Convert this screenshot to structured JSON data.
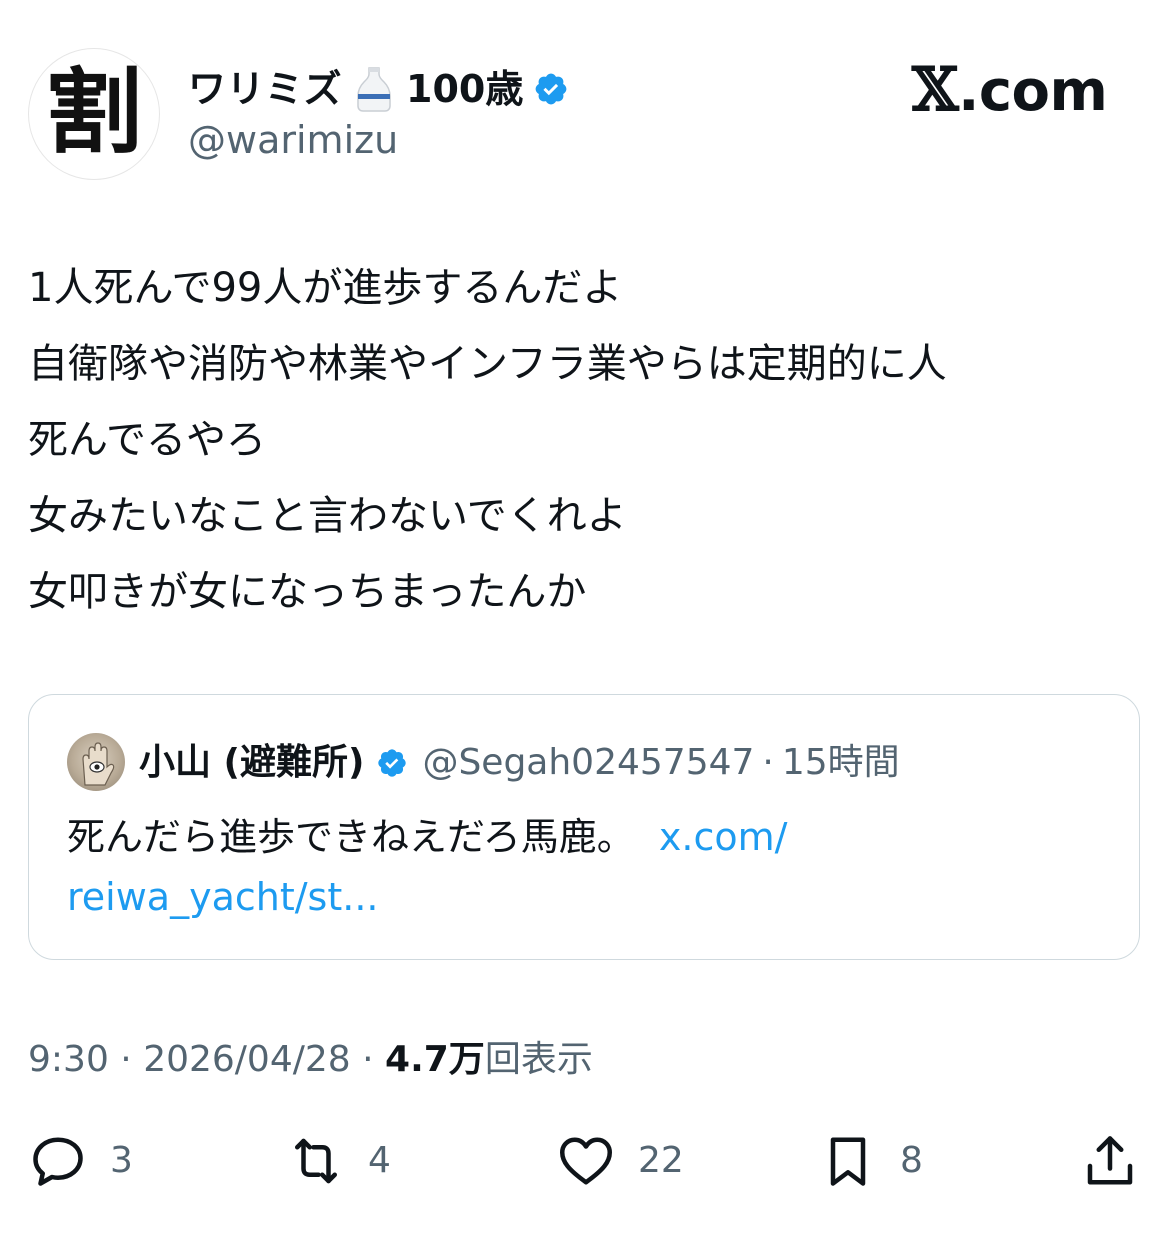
{
  "author": {
    "avatar_glyph": "割",
    "display_name": "ワリミズ",
    "emoji_icon": "sake-bottle-icon",
    "age_label": "100歳",
    "handle": "@warimizu",
    "verified": true
  },
  "site_label": {
    "x": "𝕏",
    "rest": ".com"
  },
  "tweet": {
    "lines": [
      "1人死んで99人が進歩するんだよ",
      "自衛隊や消防や林業やインフラ業やらは定期的に人",
      "死んでるやろ",
      "女みたいなこと言わないでくれよ",
      "女叩きが女になっちまったんか"
    ]
  },
  "quote": {
    "name": "小山 (避難所)",
    "handle": "@Segah02457547",
    "separator": "·",
    "time": "15時間",
    "text": "死んだら進歩できねえだろ馬鹿。",
    "link_part1": "x.com/",
    "link_part2": "reiwa_yacht/st..."
  },
  "meta": {
    "time": "9:30",
    "sep1": " · ",
    "date": "2026/04/28",
    "sep2": " · ",
    "views_count": "4.7万",
    "views_label": "回表示"
  },
  "actions": {
    "replies": "3",
    "reposts": "4",
    "likes": "22",
    "bookmarks": "8"
  },
  "colors": {
    "text": "#0f1419",
    "muted": "#536471",
    "link": "#1d9bf0",
    "verified": "#1d9bf0",
    "border": "#cfd9de"
  }
}
